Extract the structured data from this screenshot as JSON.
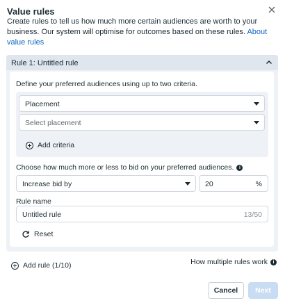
{
  "dialog": {
    "title": "Value rules",
    "description": "Create rules to tell us how much more certain audiences are worth to your business. Our system will optimise for outcomes based on these rules.",
    "about_link": "About value rules"
  },
  "rule": {
    "header": "Rule 1: Untitled rule",
    "define_text": "Define your preferred audiences using up to two criteria.",
    "criteria_select": "Placement",
    "placement_placeholder": "Select placement",
    "add_criteria": "Add criteria",
    "bid_text": "Choose how much more or less to bid on your preferred audiences.",
    "bid_action": "Increase bid by",
    "bid_value": "20",
    "bid_unit": "%",
    "rule_name_label": "Rule name",
    "rule_name_value": "Untitled rule",
    "rule_name_count": "13/50",
    "reset": "Reset"
  },
  "footer": {
    "add_rule": "Add rule (1/10)",
    "how_rules": "How multiple rules work",
    "cancel": "Cancel",
    "next": "Next"
  },
  "icons": {
    "close": "close-icon",
    "collapse": "chevron-up-icon",
    "add": "plus-circle-icon",
    "reset": "refresh-icon",
    "info": "info-icon"
  },
  "colors": {
    "link": "#0a66c2",
    "next_disabled": "#c8dcf3",
    "card_bg": "#eef2f6"
  }
}
